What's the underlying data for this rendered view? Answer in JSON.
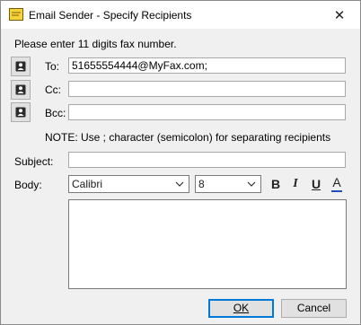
{
  "window": {
    "title": "Email Sender - Specify Recipients",
    "close_glyph": "✕",
    "app_icon": "envelope-icon"
  },
  "instructions": "Please enter 11 digits fax number.",
  "recipients": {
    "to_label": "To:",
    "to_value": "51655554444@MyFax.com;",
    "cc_label": "Cc:",
    "cc_value": "",
    "bcc_label": "Bcc:",
    "bcc_value": "",
    "address_book_icon": "address-book-icon",
    "note": "NOTE: Use ; character (semicolon) for separating recipients"
  },
  "subject": {
    "label": "Subject:",
    "value": ""
  },
  "body": {
    "label": "Body:",
    "font": "Calibri",
    "size": "8",
    "bold_glyph": "B",
    "italic_glyph": "I",
    "underline_glyph": "U",
    "color_glyph": "A",
    "text": ""
  },
  "buttons": {
    "ok": "OK",
    "cancel": "Cancel"
  },
  "colors": {
    "accent": "#0078d7",
    "window_bg": "#f0f0f0",
    "font_color_bar": "#1f4fbf"
  }
}
